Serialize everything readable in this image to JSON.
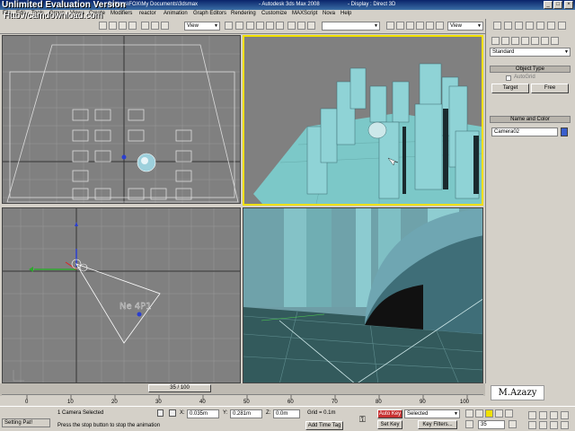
{
  "title_bar": {
    "path_text": "Settings\\FOX\\My Documents\\3dsmax",
    "app_title": "- Autodesk 3ds Max 2008",
    "display_mode": "- Display : Direct 3D"
  },
  "watermark": {
    "line1": "Unlimited Evaluation Version",
    "line2": "Http://camdownload.com"
  },
  "menu": [
    "File",
    "Edit",
    "Tools",
    "Group",
    "Views",
    "Create",
    "Modifiers",
    "reactor",
    "Animation",
    "Graph Editors",
    "Rendering",
    "Customize",
    "MAXScript",
    "Nova",
    "Help"
  ],
  "toolbar": {
    "ref_coord": "View",
    "selection_set": "",
    "view_dropdown": "View"
  },
  "command_panel": {
    "category": "Standard",
    "object_type_header": "Object Type",
    "autogrid_label": "AutoGrid",
    "target_button": "Target",
    "free_button": "Free",
    "name_color_header": "Name and Color",
    "object_name": "Camera02",
    "object_color": "#3a5fcd"
  },
  "timeline": {
    "slider_label": "35 / 100",
    "ticks": [
      "0",
      "10",
      "20",
      "30",
      "40",
      "50",
      "60",
      "70",
      "80",
      "90",
      "100"
    ]
  },
  "status": {
    "selection_count": "1 Camera Selected",
    "prompt": "Press the stop button to stop the animation",
    "x_label": "X:",
    "x_value": "0.035m",
    "y_label": "Y:",
    "y_value": "0.281m",
    "z_label": "Z:",
    "z_value": "0.0m",
    "grid": "Grid = 0.1m",
    "add_time_tag": "Add Time Tag",
    "auto_key": "Auto Key",
    "set_key": "Set Key",
    "key_mode": "Selected",
    "key_filters": "Key Filters...",
    "frame": "35",
    "listener": "Setting Pat!"
  },
  "signature": "M.Azazy",
  "colors": {
    "active_viewport_border": "#f0e000",
    "auto_key_active": "#c83232"
  }
}
